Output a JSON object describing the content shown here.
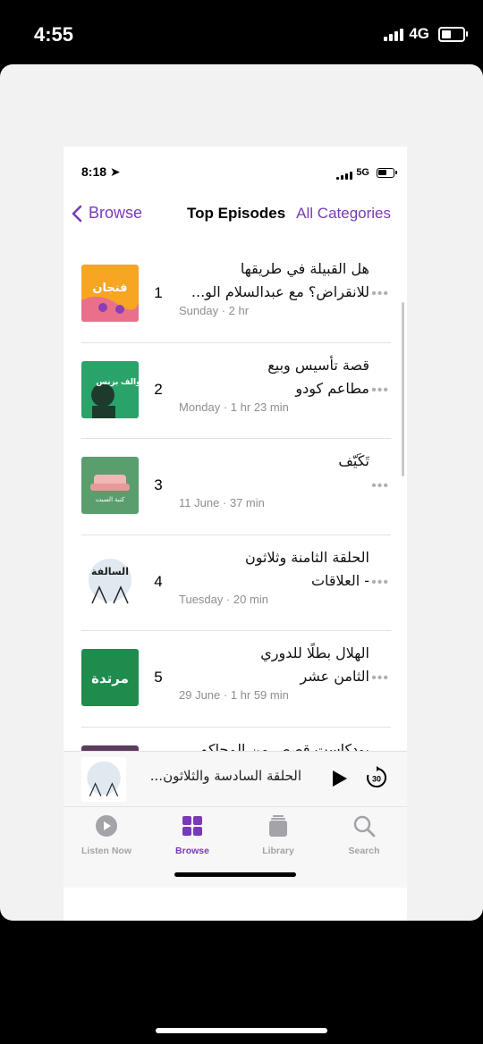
{
  "outer_status": {
    "time": "4:55",
    "network": "4G"
  },
  "inner_status": {
    "time": "8:18",
    "network": "5G"
  },
  "nav": {
    "back_label": "Browse",
    "title": "Top Episodes",
    "right_label": "All Categories"
  },
  "episodes": [
    {
      "rank": "1",
      "title": "هل القبيلة في طريقها\nللانقراض؟ مع عبدالسلام الو...",
      "meta": "Sunday · 2 hr",
      "art_text": "فنجان",
      "art_color": "#f6a623"
    },
    {
      "rank": "2",
      "title": "قصة تأسيس وبيع\nمطاعم كودو",
      "meta": "Monday · 1 hr 23 min",
      "art_text": "سوالف بزنس",
      "art_color": "#2aa36a"
    },
    {
      "rank": "3",
      "title": "تَكَيّف",
      "meta": "11 June · 37 min",
      "art_text": "كنبة السبت",
      "art_color": "#5a9e6e"
    },
    {
      "rank": "4",
      "title": "الحلقة الثامنة وثلاثون\n- العلاقات",
      "meta": "Tuesday · 20 min",
      "art_text": "السالفة",
      "art_color": "#dfe9ef"
    },
    {
      "rank": "5",
      "title": "الهلال بطلًا للدوري\nالثامن عشر",
      "meta": "29 June · 1 hr 59 min",
      "art_text": "مرتدة",
      "art_color": "#1f8b4c"
    },
    {
      "rank": "",
      "title": "بودكاست قصص من المحاكم",
      "meta": "",
      "art_text": "",
      "art_color": "#5c3a5e"
    }
  ],
  "mini_player": {
    "title": "الحلقة السادسة والثلاثون...",
    "skip_label": "30"
  },
  "tabs": [
    {
      "label": "Listen Now",
      "icon": "play-circle-icon"
    },
    {
      "label": "Browse",
      "icon": "grid-icon"
    },
    {
      "label": "Library",
      "icon": "library-stack-icon"
    },
    {
      "label": "Search",
      "icon": "magnifier-icon"
    }
  ],
  "colors": {
    "accent": "#7a3ab8"
  }
}
